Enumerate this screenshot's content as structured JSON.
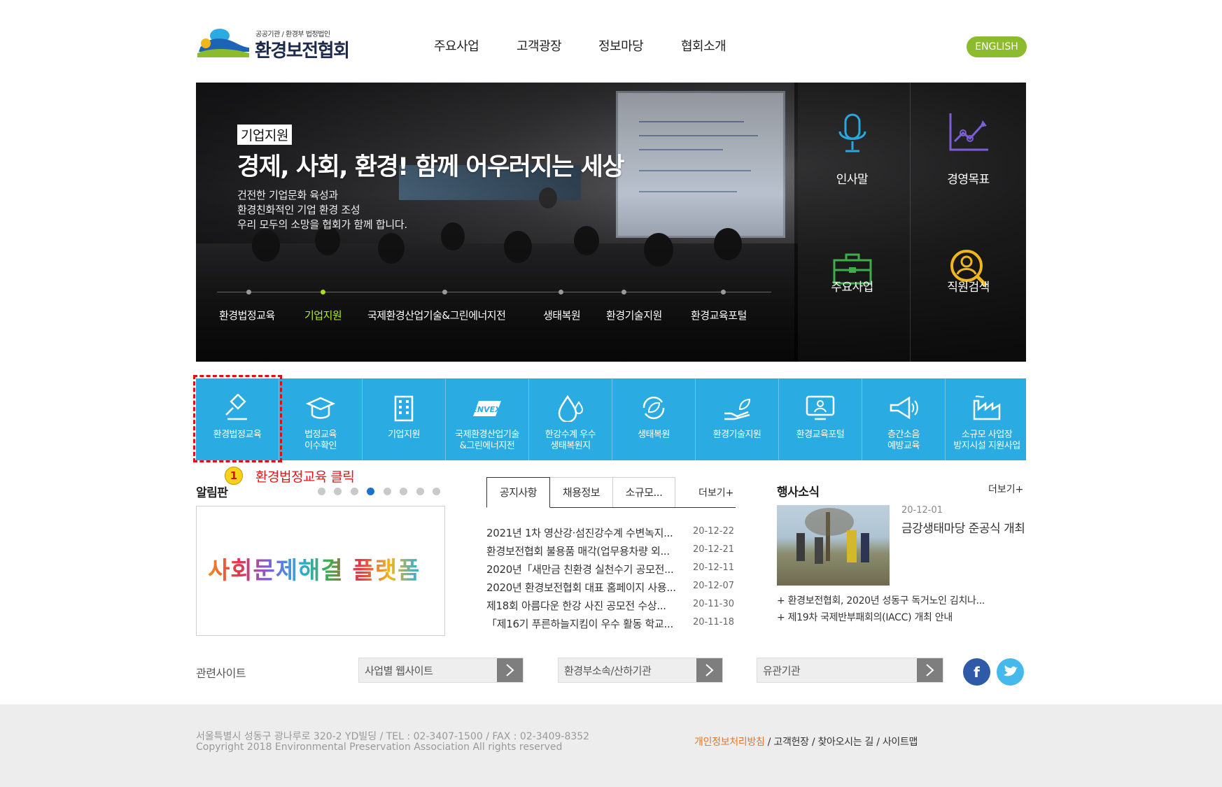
{
  "header": {
    "logo_subtitle": "공공기관 / 환경부 법정법인",
    "logo_name": "환경보전협회",
    "nav": [
      "주요사업",
      "고객광장",
      "정보마당",
      "협회소개"
    ],
    "english_label": "ENGLISH"
  },
  "hero": {
    "tag": "기업지원",
    "title": "경제, 사회, 환경! 함께 어우러지는 세상",
    "desc": [
      "건전한 기업문화 육성과",
      "환경친화적인 기업 환경 조성",
      "우리 모두의 소망을 협회가 함께 합니다."
    ],
    "tabs": [
      "환경법정교육",
      "기업지원",
      "국제환경산업기술&그린에너지전",
      "생태복원",
      "환경기술지원",
      "환경교육포털"
    ],
    "active_tab_index": 1,
    "quick_links": [
      "인사말",
      "경영목표",
      "주요사업",
      "직원검색"
    ]
  },
  "blue_menu": {
    "items": [
      {
        "label": "환경법정교육",
        "icon": "gavel-icon"
      },
      {
        "label": "법정교육\n이수확인",
        "icon": "graduation-cap-icon"
      },
      {
        "label": "기업지원",
        "icon": "building-icon"
      },
      {
        "label": "국제환경산업기술\n&그린에너지전",
        "icon": "envex-logo-icon"
      },
      {
        "label": "한강수계 우수\n생태복원지",
        "icon": "water-drop-icon"
      },
      {
        "label": "생태복원",
        "icon": "leaf-cycle-icon"
      },
      {
        "label": "환경기술지원",
        "icon": "hand-plant-icon"
      },
      {
        "label": "환경교육포털",
        "icon": "monitor-user-icon"
      },
      {
        "label": "층간소음\n예방교육",
        "icon": "megaphone-icon"
      },
      {
        "label": "소규모 사업장\n방지시설 지원사업",
        "icon": "factory-icon"
      }
    ],
    "bg_color": "#2aace2"
  },
  "annotation": {
    "number": "1",
    "text": "환경법정교육 클릭"
  },
  "notice_board": {
    "title": "알림판",
    "pager_count": 8,
    "pager_active": 3,
    "banner_text": "사회문제해결 플랫폼"
  },
  "news": {
    "tabs": [
      "공지사항",
      "채용정보",
      "소규모..."
    ],
    "more": "더보기+",
    "items": [
      {
        "title": "2021년 1차 영산강·섬진강수계 수변녹지...",
        "date": "20-12-22"
      },
      {
        "title": "환경보전협회 불용품 매각(업무용차량 외...",
        "date": "20-12-21"
      },
      {
        "title": "2020년「새만금 친환경 실천수기 공모전...",
        "date": "20-12-11"
      },
      {
        "title": "2020년 환경보전협회 대표 홈페이지 사용...",
        "date": "20-12-07"
      },
      {
        "title": "제18회 아름다운 한강 사진 공모전 수상...",
        "date": "20-11-30"
      },
      {
        "title": "「제16기 푸른하늘지킴이 우수 활동 학교...",
        "date": "20-11-18"
      }
    ]
  },
  "events": {
    "title": "행사소식",
    "more": "더보기+",
    "featured_date": "20-12-01",
    "featured_title": "금강생태마당 준공식 개최",
    "items": [
      "+ 환경보전협회, 2020년 성동구 독거노인 김치나...",
      "+ 제19차 국제반부패회의(IACC) 개최 안내"
    ]
  },
  "related": {
    "label": "관련사이트",
    "selects": [
      "사업별 웹사이트",
      "환경부소속/산하기관",
      "유관기관"
    ]
  },
  "footer": {
    "address": "서울특별시 성동구 광나루로 320-2 YD빌딩 / TEL : 02-3407-1500 / FAX : 02-3409-8352",
    "copyright": "Copyright 2018 Environmental Preservation Association All rights reserved",
    "links": [
      "개인정보처리방침",
      "고객헌장",
      "찾아오시는 길",
      "사이트맵"
    ]
  }
}
